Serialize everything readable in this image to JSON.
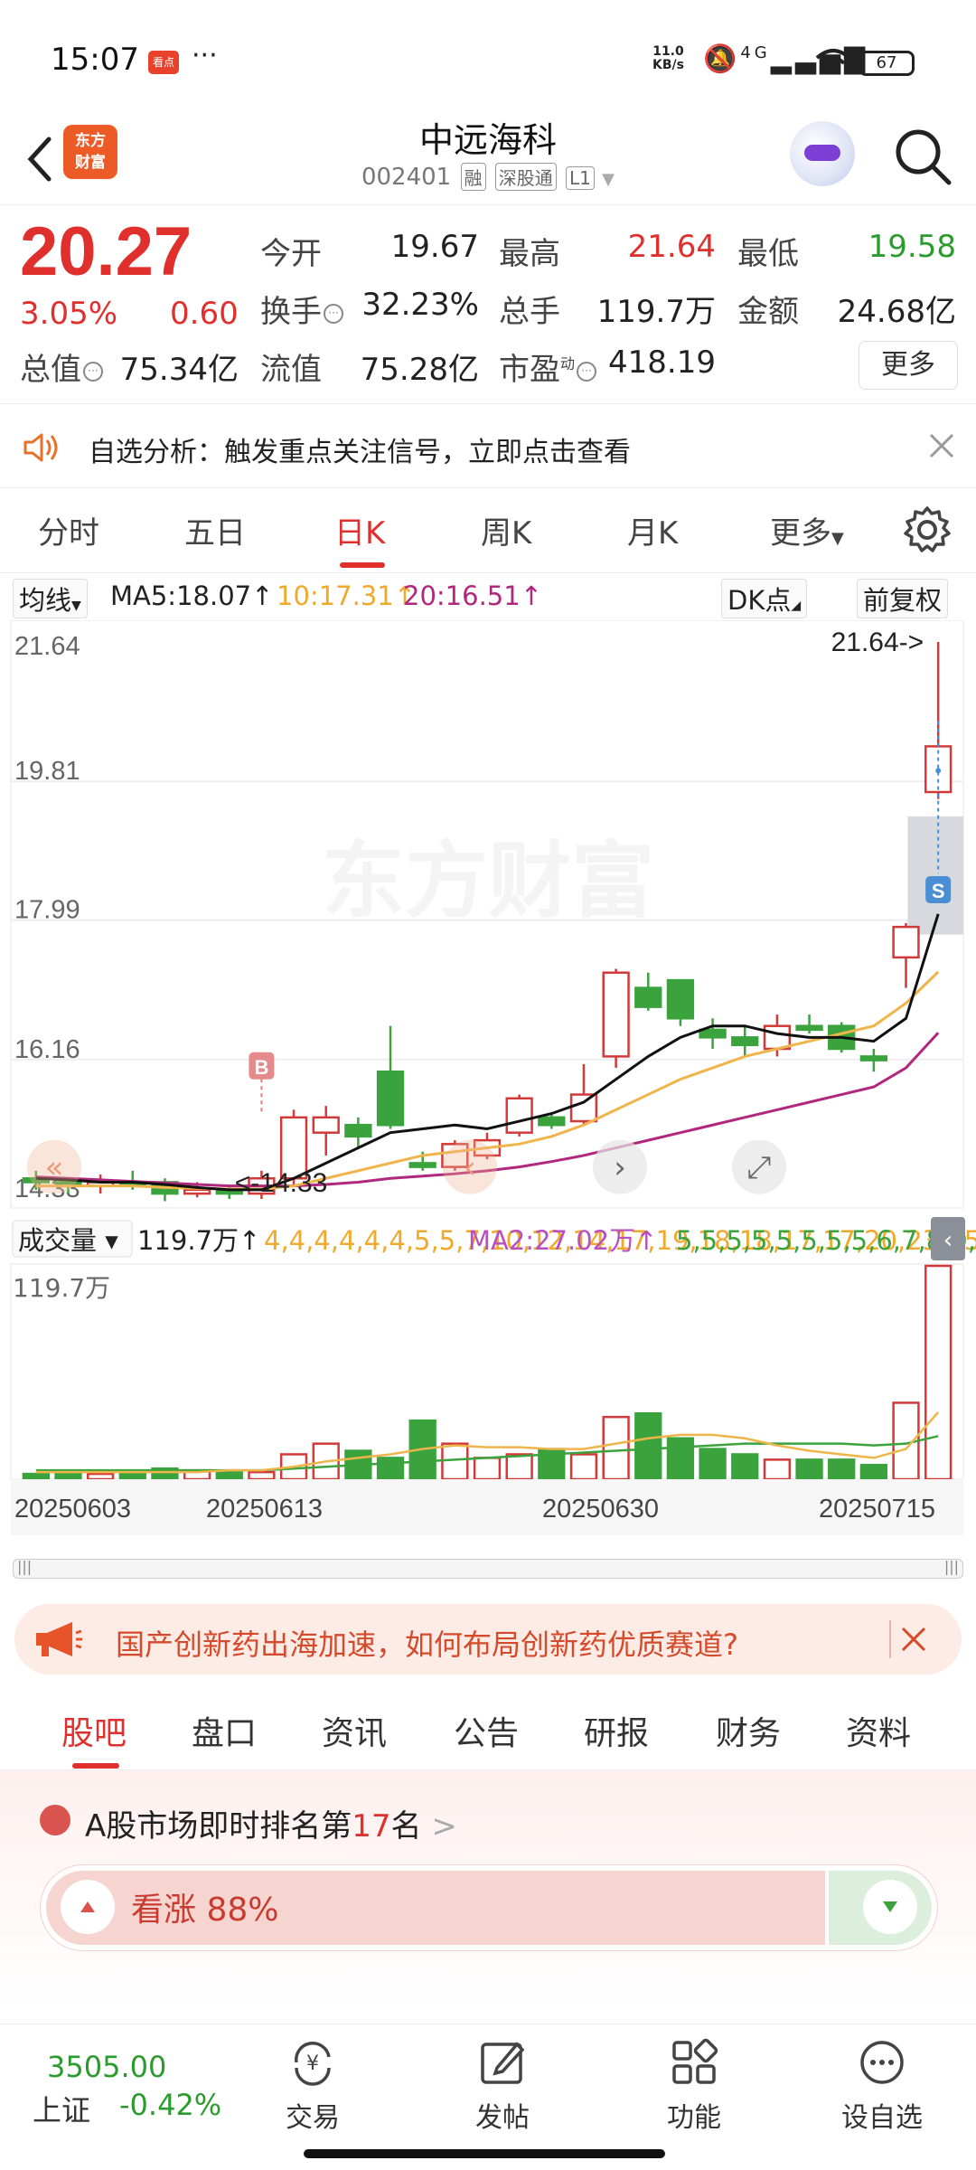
{
  "status_bar": {
    "time": "15:07",
    "app_badge": "看点",
    "more": "···",
    "net_speed": "11.0",
    "net_unit": "KB/s",
    "signal": "4G",
    "battery": "67"
  },
  "header": {
    "logo_line1": "东方",
    "logo_line2": "财富",
    "name": "中远海科",
    "code": "002401",
    "tags": [
      "融",
      "深股通",
      "L1"
    ]
  },
  "quote": {
    "price": "20.27",
    "change_pct": "3.05%",
    "change": "0.60",
    "fields": [
      {
        "label": "今开",
        "value": "19.67",
        "color": "#222222"
      },
      {
        "label": "最高",
        "value": "21.64",
        "color": "#e0302d"
      },
      {
        "label": "最低",
        "value": "19.58",
        "color": "#2b9b2e"
      },
      {
        "label": "换手",
        "value": "32.23%",
        "color": "#222222"
      },
      {
        "label": "总手",
        "value": "119.7万",
        "color": "#222222"
      },
      {
        "label": "金额",
        "value": "24.68亿",
        "color": "#222222"
      },
      {
        "label": "总值",
        "value": "75.34亿",
        "color": "#222222"
      },
      {
        "label": "流值",
        "value": "75.28亿",
        "color": "#222222"
      },
      {
        "label": "市盈",
        "value": "418.19",
        "color": "#222222"
      }
    ],
    "pe_superscript": "动",
    "more_label": "更多"
  },
  "banner": {
    "text": "自选分析：触发重点关注信号，立即点击查看"
  },
  "period_tabs": [
    "分时",
    "五日",
    "日K",
    "周K",
    "月K",
    "更多"
  ],
  "period_active": 2,
  "ma_row": {
    "selector": "均线",
    "ma5": "MA5:18.07",
    "ma10": "10:17.31",
    "ma20": "20:16.51",
    "dk": "DK点",
    "adjust": "前复权"
  },
  "chart_data": {
    "type": "candlestick",
    "y_ticks": [
      "21.64",
      "19.81",
      "17.99",
      "16.16",
      "14.33"
    ],
    "ylim": [
      14.33,
      21.64
    ],
    "annotations": {
      "high": "21.64->",
      "low": "<-14.33",
      "buy_marker": "B",
      "sell_marker": "S"
    },
    "watermark": "东方财富",
    "candles": [
      {
        "o": 14.6,
        "c": 14.55,
        "h": 14.7,
        "l": 14.45
      },
      {
        "o": 14.55,
        "c": 14.5,
        "h": 14.6,
        "l": 14.4
      },
      {
        "o": 14.5,
        "c": 14.55,
        "h": 14.65,
        "l": 14.4
      },
      {
        "o": 14.55,
        "c": 14.5,
        "h": 14.7,
        "l": 14.45
      },
      {
        "o": 14.55,
        "c": 14.4,
        "h": 14.6,
        "l": 14.3
      },
      {
        "o": 14.4,
        "c": 14.45,
        "h": 14.55,
        "l": 14.35
      },
      {
        "o": 14.45,
        "c": 14.4,
        "h": 14.5,
        "l": 14.33
      },
      {
        "o": 14.4,
        "c": 14.6,
        "h": 14.7,
        "l": 14.33
      },
      {
        "o": 14.6,
        "c": 15.4,
        "h": 15.5,
        "l": 14.5
      },
      {
        "o": 15.2,
        "c": 15.4,
        "h": 15.55,
        "l": 14.9
      },
      {
        "o": 15.3,
        "c": 15.15,
        "h": 15.4,
        "l": 15.0
      },
      {
        "o": 16.0,
        "c": 15.3,
        "h": 16.6,
        "l": 15.25
      },
      {
        "o": 14.8,
        "c": 14.75,
        "h": 14.95,
        "l": 14.7
      },
      {
        "o": 14.75,
        "c": 15.05,
        "h": 15.1,
        "l": 14.7
      },
      {
        "o": 14.9,
        "c": 15.1,
        "h": 15.2,
        "l": 14.85
      },
      {
        "o": 15.2,
        "c": 15.65,
        "h": 15.7,
        "l": 15.15
      },
      {
        "o": 15.4,
        "c": 15.3,
        "h": 15.45,
        "l": 15.25
      },
      {
        "o": 15.35,
        "c": 15.7,
        "h": 16.1,
        "l": 15.3
      },
      {
        "o": 16.2,
        "c": 17.3,
        "h": 17.35,
        "l": 16.05
      },
      {
        "o": 17.1,
        "c": 16.85,
        "h": 17.3,
        "l": 16.8
      },
      {
        "o": 17.2,
        "c": 16.7,
        "h": 17.2,
        "l": 16.6
      },
      {
        "o": 16.55,
        "c": 16.45,
        "h": 16.7,
        "l": 16.3
      },
      {
        "o": 16.45,
        "c": 16.35,
        "h": 16.6,
        "l": 16.2
      },
      {
        "o": 16.3,
        "c": 16.6,
        "h": 16.75,
        "l": 16.2
      },
      {
        "o": 16.6,
        "c": 16.55,
        "h": 16.75,
        "l": 16.5
      },
      {
        "o": 16.6,
        "c": 16.3,
        "h": 16.65,
        "l": 16.25
      },
      {
        "o": 16.2,
        "c": 16.15,
        "h": 16.3,
        "l": 16.0
      },
      {
        "o": 17.5,
        "c": 17.9,
        "h": 17.95,
        "l": 17.1
      },
      {
        "o": 19.67,
        "c": 20.27,
        "h": 21.64,
        "l": 19.58
      }
    ],
    "ma5": [
      14.6,
      14.58,
      14.55,
      14.55,
      14.52,
      14.48,
      14.45,
      14.45,
      14.6,
      14.8,
      15.0,
      15.2,
      15.25,
      15.3,
      15.25,
      15.35,
      15.45,
      15.6,
      15.9,
      16.2,
      16.45,
      16.6,
      16.6,
      16.5,
      16.45,
      16.45,
      16.4,
      16.7,
      18.07
    ],
    "ma10": [
      14.5,
      14.5,
      14.5,
      14.5,
      14.48,
      14.47,
      14.46,
      14.46,
      14.5,
      14.6,
      14.7,
      14.8,
      14.9,
      14.95,
      15.0,
      15.05,
      15.15,
      15.3,
      15.5,
      15.7,
      15.9,
      16.05,
      16.2,
      16.3,
      16.4,
      16.5,
      16.6,
      16.9,
      17.31
    ],
    "ma20": [
      14.62,
      14.6,
      14.58,
      14.56,
      14.54,
      14.52,
      14.5,
      14.5,
      14.5,
      14.52,
      14.55,
      14.6,
      14.63,
      14.66,
      14.7,
      14.75,
      14.82,
      14.9,
      15.0,
      15.1,
      15.2,
      15.3,
      15.4,
      15.5,
      15.6,
      15.7,
      15.8,
      16.05,
      16.51
    ],
    "x_labels": [
      "20250603",
      "20250613",
      "20250630",
      "20250715"
    ]
  },
  "volume": {
    "selector": "成交量",
    "value": "119.7万",
    "ma1": [
      4,
      4,
      4,
      4,
      4,
      4,
      5,
      5,
      7,
      10,
      12,
      14,
      17,
      19,
      18,
      18,
      17,
      17,
      20,
      23,
      25,
      25,
      23,
      19,
      16,
      14,
      12,
      17,
      37.69
    ],
    "ma2": "MA2:27.02万",
    "ma3": [
      5,
      5,
      5,
      5,
      5,
      5,
      5,
      5,
      6,
      7,
      8,
      9,
      10,
      11,
      12,
      13,
      14,
      15,
      16,
      17,
      18,
      19,
      20,
      20,
      20,
      20,
      19,
      20,
      24.26
    ],
    "ymax_label": "119.7万",
    "bars": [
      3,
      3,
      3,
      3,
      6,
      5,
      4,
      4,
      14,
      20,
      16,
      12,
      33,
      20,
      12,
      14,
      17,
      14,
      35,
      37,
      23,
      17,
      14,
      11,
      11,
      11,
      8,
      43,
      120
    ]
  },
  "scrollbar": {
    "left_handle": "|||",
    "right_handle": "|||"
  },
  "ad": {
    "text": "国产创新药出海加速，如何布局创新药优质赛道?"
  },
  "content_tabs": [
    "股吧",
    "盘口",
    "资讯",
    "公告",
    "研报",
    "财务",
    "资料"
  ],
  "content_active": 0,
  "ranking": {
    "prefix": "A股市场即时排名第",
    "rank": "17",
    "suffix": "名",
    "arrow": ">",
    "sentiment_label": "看涨 88%",
    "bull_pct": 88
  },
  "bottom_nav": {
    "index_value": "3505.00",
    "index_name": "上证",
    "index_change": "-0.42%",
    "items": [
      "交易",
      "发帖",
      "功能",
      "设自选"
    ]
  }
}
